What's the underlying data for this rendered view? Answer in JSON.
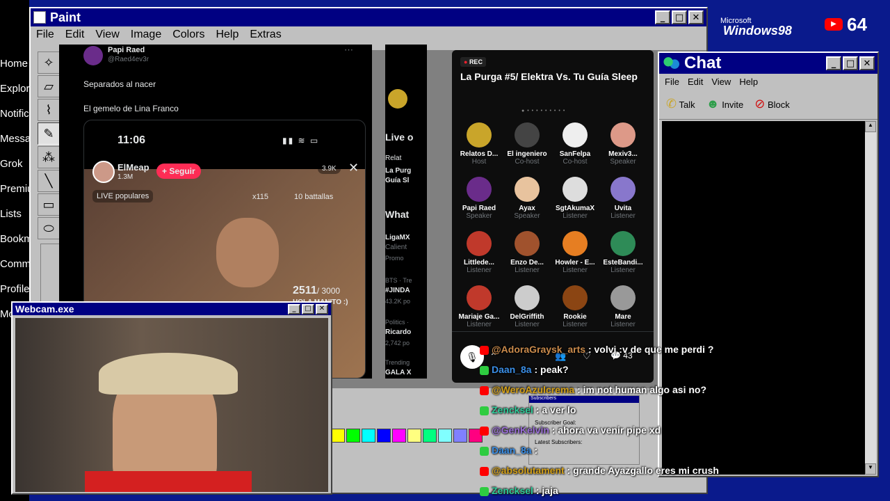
{
  "x_sidebar": {
    "items": [
      "Home",
      "Explor",
      "Notific",
      "Messa",
      "Grok",
      "Premiu",
      "Lists",
      "Bookm",
      "Comm",
      "Profile",
      "Mo"
    ]
  },
  "paint": {
    "title": "Paint",
    "menus": [
      "File",
      "Edit",
      "View",
      "Image",
      "Colors",
      "Help",
      "Extras"
    ]
  },
  "tweet": {
    "name": "Papi Raed",
    "handle": "@Raed4ev3r",
    "line1": "Separados al nacer",
    "line2": "El gemelo de Lina Franco",
    "time": "11:06",
    "streamer": "ElMeap",
    "followers": "1.3M",
    "follow_btn": "+ Seguir",
    "viewers": "3.9K",
    "badge": "LIVE populares",
    "gifts": "x115",
    "battles": "10 battallas",
    "goal_value": "2511",
    "goal_total": "/ 3000",
    "goal_msg": "HOLA MANITO :)"
  },
  "feed": {
    "live_heading": "Live o",
    "relat": "Relat",
    "la_purga": "La Purg",
    "guia": "Guía Sl",
    "whats": "What",
    "ligamx": "LigaMX",
    "caliente": "Calient",
    "promo": "Promo",
    "bts": "BTS · Tre",
    "jinda": "#JINDA",
    "posts": "43.2K po",
    "politics": "Politics ·",
    "ricardo": "Ricardo",
    "posts2": "2,742 po",
    "trending": "Trending",
    "gala": "GALA X"
  },
  "spaces": {
    "rec": "REC",
    "title": "La Purga #5/ Elektra Vs. Tu Guía Sleep",
    "comments": "43",
    "participants": [
      {
        "name": "Relatos D...",
        "role": "Host"
      },
      {
        "name": "El ingeniero",
        "role": "Co-host"
      },
      {
        "name": "SanFelpa",
        "role": "Co-host"
      },
      {
        "name": "Mexiv3...",
        "role": "Speaker"
      },
      {
        "name": "Papi Raed",
        "role": "Speaker"
      },
      {
        "name": "Ayax",
        "role": "Speaker"
      },
      {
        "name": "SgtAkumaX",
        "role": "Listener"
      },
      {
        "name": "Uvita",
        "role": "Listener"
      },
      {
        "name": "Littlede...",
        "role": "Listener"
      },
      {
        "name": "Enzo De...",
        "role": "Listener"
      },
      {
        "name": "Howler - E...",
        "role": "Listener"
      },
      {
        "name": "EsteBandi...",
        "role": "Listener"
      },
      {
        "name": "Mariaje Ga...",
        "role": "Listener"
      },
      {
        "name": "DelGriffith",
        "role": "Listener"
      },
      {
        "name": "Rookie",
        "role": "Listener"
      },
      {
        "name": "Mare",
        "role": "Listener"
      }
    ]
  },
  "chatwin": {
    "title": "Chat",
    "menus": [
      "File",
      "Edit",
      "View",
      "Help"
    ],
    "talk": "Talk",
    "invite": "Invite",
    "block": "Block"
  },
  "brand": {
    "microsoft": "Microsoft",
    "windows": "Windows98",
    "count": "64"
  },
  "webcam": {
    "title": "Webcam.exe"
  },
  "subs": {
    "title": "Subscribers",
    "goal": "Subscriber Goal:",
    "latest": "Latest Subscribers:"
  },
  "messages": [
    {
      "user": "@AdoraGraysk_arts",
      "text": " : volvi :v de que me perdi ?",
      "color": "#c98a4b"
    },
    {
      "user": "Daan_8a",
      "text": " : peak?",
      "color": "#3a8ee6"
    },
    {
      "user": "@WeroAzulcrema",
      "text": " : im not human algo asi no?",
      "color": "#d4a017"
    },
    {
      "user": "Zencksel",
      "text": " : a ver lo",
      "color": "#2ecc9a"
    },
    {
      "user": "@GenKelvin",
      "text": " : ahora va venir pipe xd",
      "color": "#9b6fd8"
    },
    {
      "user": "Daan_8a",
      "text": " :",
      "color": "#3a8ee6"
    },
    {
      "user": "@absolutament",
      "text": " : grande Ayazgallo eres mi crush",
      "color": "#d4a017"
    },
    {
      "user": "Zencksel",
      "text": " : jaja",
      "color": "#2ecc9a"
    }
  ]
}
